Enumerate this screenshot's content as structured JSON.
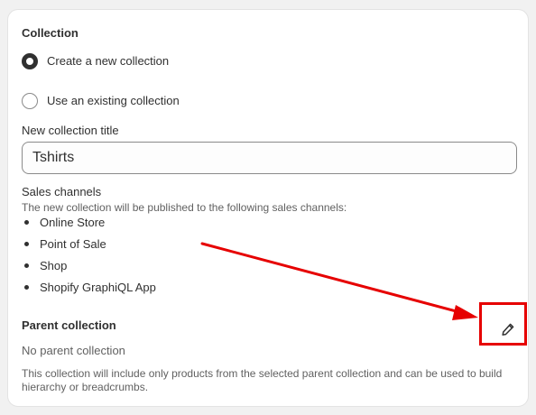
{
  "collection": {
    "heading": "Collection",
    "options": [
      {
        "label": "Create a new collection",
        "selected": true
      },
      {
        "label": "Use an existing collection",
        "selected": false
      }
    ],
    "title_field": {
      "label": "New collection title",
      "value": "Tshirts"
    }
  },
  "sales_channels": {
    "heading": "Sales channels",
    "description": "The new collection will be published to the following sales channels:",
    "items": [
      "Online Store",
      "Point of Sale",
      "Shop",
      "Shopify GraphiQL App"
    ]
  },
  "parent_collection": {
    "heading": "Parent collection",
    "value": "No parent collection",
    "help": "This collection will include only products from the selected parent collection and can be used to build hierarchy or breadcrumbs.",
    "edit_icon": "pencil-icon"
  },
  "annotation": {
    "color": "#e60000"
  },
  "colors": {
    "text": "#303030",
    "muted": "#616161",
    "border": "#8a8a8a"
  }
}
